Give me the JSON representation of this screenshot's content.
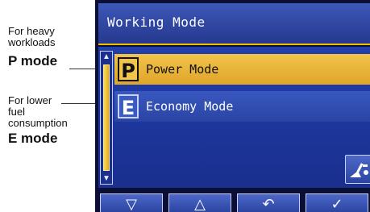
{
  "annotations": {
    "heavy_line1": "For heavy",
    "heavy_line2": "workloads",
    "p_mode": "P mode",
    "fuel_line1": "For lower",
    "fuel_line2": "fuel",
    "fuel_line3": "consumption",
    "e_mode": "E mode"
  },
  "screen": {
    "title": "Working Mode",
    "modes": [
      {
        "badge": "P",
        "label": "Power Mode",
        "selected": true
      },
      {
        "badge": "E",
        "label": "Economy Mode",
        "selected": false
      }
    ],
    "scroll": {
      "up": "▲",
      "down": "▼"
    },
    "side_button_icon": "attachment-icon",
    "soft_keys": [
      {
        "icon": "down-arrow-icon",
        "glyph": "▽"
      },
      {
        "icon": "up-arrow-icon",
        "glyph": "△"
      },
      {
        "icon": "back-icon",
        "glyph": "↶"
      },
      {
        "icon": "confirm-icon",
        "glyph": "✓"
      }
    ]
  },
  "colors": {
    "selected_row": "#f3c44a",
    "row": "#2a44a4",
    "title_bar": "#26388e",
    "accent": "#f0c000"
  }
}
